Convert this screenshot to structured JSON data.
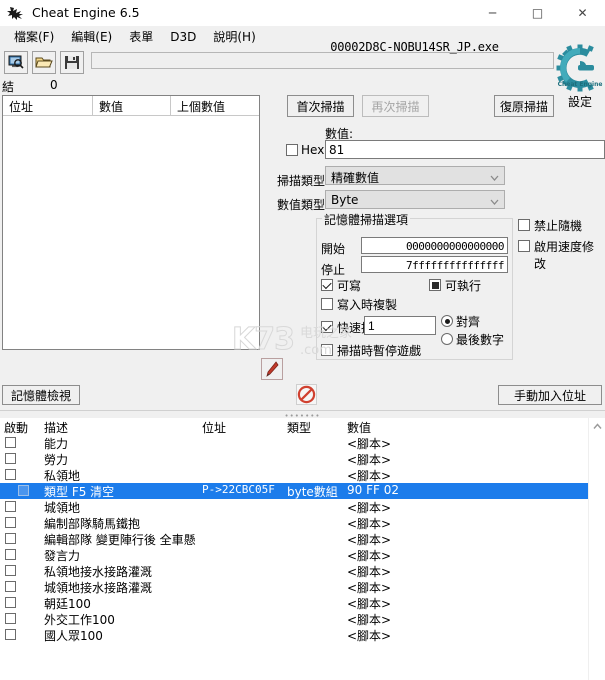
{
  "window": {
    "title": "Cheat Engine 6.5",
    "icon": "cheat-engine-logo-icon",
    "controls": {
      "minimize": "─",
      "maximize": "□",
      "close": "✕"
    }
  },
  "menu": {
    "items": [
      {
        "label": "檔案(F)",
        "accel": "F"
      },
      {
        "label": "編輯(E)",
        "accel": "E"
      },
      {
        "label": "表單",
        "accel": ""
      },
      {
        "label": "D3D",
        "accel": ""
      },
      {
        "label": "說明(H)",
        "accel": "H"
      }
    ]
  },
  "toolbar": {
    "buttons": [
      {
        "name": "open-process-button",
        "icon": "computer-magnifier-icon"
      },
      {
        "name": "open-file-button",
        "icon": "folder-open-icon"
      },
      {
        "name": "save-file-button",
        "icon": "floppy-disk-icon"
      }
    ],
    "process_title": "00002D8C-NOBU14SR_JP.exe"
  },
  "results": {
    "label": "結果",
    "count": "0",
    "columns": [
      "位址",
      "數值",
      "上個數值"
    ],
    "rows": []
  },
  "scan": {
    "first_scan": "首次掃描",
    "next_scan": "再次掃描",
    "undo_scan": "復原掃描",
    "settings_label": "設定",
    "value_label": "數值:",
    "hex_label": "Hex",
    "hex_checked": false,
    "value": "81",
    "scan_type_label": "掃描類型",
    "scan_type_value": "精確數值",
    "value_type_label": "數值類型",
    "value_type_value": "Byte"
  },
  "memory_options": {
    "group_title": "記憶體掃描選項",
    "start_label": "開始",
    "start_value": "0000000000000000",
    "stop_label": "停止",
    "stop_value": "7fffffffffffffff",
    "writable_label": "可寫",
    "writable_checked": true,
    "executable_label": "可執行",
    "executable_state": "grayed",
    "copy_on_write_label": "寫入時複製",
    "copy_on_write_checked": false,
    "fast_scan_label": "快速掃描",
    "fast_scan_checked": true,
    "fast_scan_value": "1",
    "alignment_label": "對齊",
    "alignment_selected": true,
    "last_digits_label": "最後數字",
    "last_digits_selected": false,
    "pause_label": "掃描時暫停遊戲",
    "pause_checked": false
  },
  "extra_options": {
    "no_random_label": "禁止隨機",
    "no_random_checked": false,
    "speedhack_label": "啟用速度修改",
    "speedhack_checked": false
  },
  "bottom_bar": {
    "memory_view": "記憶體檢視",
    "add_address": "手動加入位址",
    "pointer_icon": "red-arrow-cursor-icon",
    "stop_icon": "red-no-entry-icon"
  },
  "watermark": {
    "main": "K73",
    "sub_line1": "电玩之家",
    "sub_line2": ".com"
  },
  "address_table": {
    "columns": [
      "啟動",
      "描述",
      "位址",
      "類型",
      "數值"
    ],
    "rows": [
      {
        "active": false,
        "description": "能力",
        "address": "",
        "type": "",
        "value": "<腳本>",
        "selected": false
      },
      {
        "active": false,
        "description": "勞力",
        "address": "",
        "type": "",
        "value": "<腳本>",
        "selected": false
      },
      {
        "active": false,
        "description": "私領地",
        "address": "",
        "type": "",
        "value": "<腳本>",
        "selected": false
      },
      {
        "active": false,
        "description": "類型 F5 清空",
        "address": "P->22CBC05F",
        "type": "byte數組",
        "value": "90 FF 02",
        "selected": true
      },
      {
        "active": false,
        "description": "城領地",
        "address": "",
        "type": "",
        "value": "<腳本>",
        "selected": false
      },
      {
        "active": false,
        "description": "編制部隊騎馬鐵抱",
        "address": "",
        "type": "",
        "value": "<腳本>",
        "selected": false
      },
      {
        "active": false,
        "description": "編輯部隊 變更陣行後 全車懸",
        "address": "",
        "type": "",
        "value": "<腳本>",
        "selected": false
      },
      {
        "active": false,
        "description": "發言力",
        "address": "",
        "type": "",
        "value": "<腳本>",
        "selected": false
      },
      {
        "active": false,
        "description": "私領地接水接路灌溉",
        "address": "",
        "type": "",
        "value": "<腳本>",
        "selected": false
      },
      {
        "active": false,
        "description": "城領地接水接路灌溉",
        "address": "",
        "type": "",
        "value": "<腳本>",
        "selected": false
      },
      {
        "active": false,
        "description": "朝廷100",
        "address": "",
        "type": "",
        "value": "<腳本>",
        "selected": false
      },
      {
        "active": false,
        "description": "外交工作100",
        "address": "",
        "type": "",
        "value": "<腳本>",
        "selected": false
      },
      {
        "active": false,
        "description": "國人眾100",
        "address": "",
        "type": "",
        "value": "<腳本>",
        "selected": false
      }
    ]
  },
  "colors": {
    "selection": "#1c7ceb",
    "logo_teal": "#2f8f9d",
    "accent_red": "#c0392b"
  }
}
